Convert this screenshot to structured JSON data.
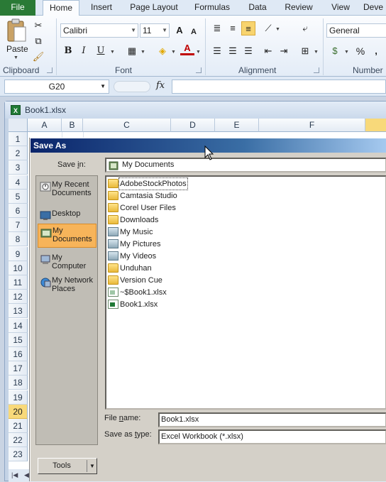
{
  "ribbon": {
    "tabs": [
      {
        "label": "File",
        "active": false
      },
      {
        "label": "Home",
        "active": true
      },
      {
        "label": "Insert",
        "active": false
      },
      {
        "label": "Page Layout",
        "active": false
      },
      {
        "label": "Formulas",
        "active": false
      },
      {
        "label": "Data",
        "active": false
      },
      {
        "label": "Review",
        "active": false
      },
      {
        "label": "View",
        "active": false
      },
      {
        "label": "Deve",
        "active": false
      }
    ],
    "clipboard": {
      "paste_label": "Paste",
      "group_label": "Clipboard"
    },
    "font": {
      "name": "Calibri",
      "size": "11",
      "group_label": "Font",
      "bold": "B",
      "italic": "I",
      "underline": "U",
      "grow": "A",
      "shrink": "A"
    },
    "alignment": {
      "group_label": "Alignment"
    },
    "number": {
      "format": "General",
      "group_label": "Number",
      "percent": "%"
    }
  },
  "formula_bar": {
    "name_box": "G20",
    "fx": "fx",
    "formula": ""
  },
  "workbook": {
    "title": "Book1.xlsx",
    "columns": [
      "A",
      "B",
      "C",
      "D",
      "E",
      "F"
    ],
    "rows": [
      "1",
      "2",
      "3",
      "4",
      "5",
      "6",
      "7",
      "8",
      "9",
      "10",
      "11",
      "12",
      "13",
      "14",
      "15",
      "16",
      "17",
      "18",
      "19",
      "20",
      "21",
      "22",
      "23"
    ],
    "selected_row": "20"
  },
  "dialog": {
    "title": "Save As",
    "save_in_label": "Save in:",
    "save_in_value": "My Documents",
    "places": [
      {
        "label": "My Recent Documents",
        "selected": false,
        "icon": "recent-documents-icon"
      },
      {
        "label": "Desktop",
        "selected": false,
        "icon": "desktop-icon"
      },
      {
        "label": "My Documents",
        "selected": true,
        "icon": "my-documents-icon"
      },
      {
        "label": "My Computer",
        "selected": false,
        "icon": "my-computer-icon"
      },
      {
        "label": "My Network Places",
        "selected": false,
        "icon": "network-places-icon"
      }
    ],
    "files": [
      {
        "name": "AdobeStockPhotos",
        "type": "folder"
      },
      {
        "name": "Camtasia Studio",
        "type": "folder"
      },
      {
        "name": "Corel User Files",
        "type": "folder"
      },
      {
        "name": "Downloads",
        "type": "folder"
      },
      {
        "name": "My Music",
        "type": "media-folder"
      },
      {
        "name": "My Pictures",
        "type": "media-folder"
      },
      {
        "name": "My Videos",
        "type": "media-folder"
      },
      {
        "name": "Unduhan",
        "type": "folder"
      },
      {
        "name": "Version Cue",
        "type": "folder"
      },
      {
        "name": "~$Book1.xlsx",
        "type": "temp-excel-file"
      },
      {
        "name": "Book1.xlsx",
        "type": "excel-file"
      }
    ],
    "file_name_label": "File name:",
    "file_name_value": "Book1.xlsx",
    "save_type_label": "Save as type:",
    "save_type_value": "Excel Workbook (*.xlsx)",
    "tools_label": "Tools"
  }
}
